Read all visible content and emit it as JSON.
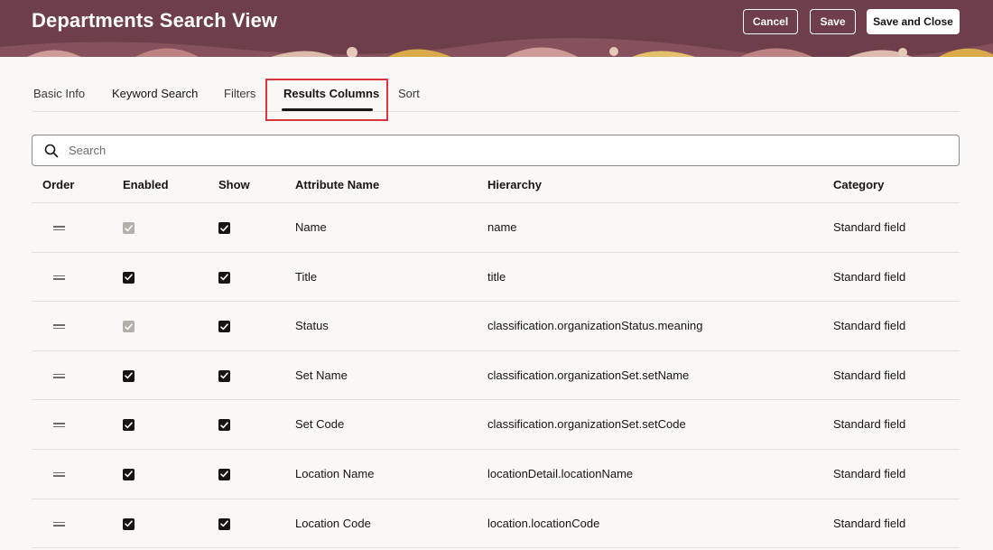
{
  "header": {
    "title": "Departments Search View",
    "cancel_label": "Cancel",
    "save_label": "Save",
    "save_close_label": "Save and Close",
    "background_color": "#6e3e4b"
  },
  "tabs": [
    {
      "label": "Basic Info",
      "selected": false
    },
    {
      "label": "Keyword Search",
      "selected": false
    },
    {
      "label": "Filters",
      "selected": false
    },
    {
      "label": "Results Columns",
      "selected": true
    },
    {
      "label": "Sort",
      "selected": false
    }
  ],
  "search": {
    "placeholder": "Search",
    "value": "",
    "icon": "search-icon"
  },
  "table": {
    "columns": [
      "Order",
      "Enabled",
      "Show",
      "Attribute Name",
      "Hierarchy",
      "Category"
    ],
    "rows": [
      {
        "enabled": "disabled-checked",
        "show": true,
        "attribute": "Name",
        "hierarchy": "name",
        "category": "Standard field"
      },
      {
        "enabled": "checked",
        "show": true,
        "attribute": "Title",
        "hierarchy": "title",
        "category": "Standard field"
      },
      {
        "enabled": "disabled-checked",
        "show": true,
        "attribute": "Status",
        "hierarchy": "classification.organizationStatus.meaning",
        "category": "Standard field"
      },
      {
        "enabled": "checked",
        "show": true,
        "attribute": "Set Name",
        "hierarchy": "classification.organizationSet.setName",
        "category": "Standard field"
      },
      {
        "enabled": "checked",
        "show": true,
        "attribute": "Set Code",
        "hierarchy": "classification.organizationSet.setCode",
        "category": "Standard field"
      },
      {
        "enabled": "checked",
        "show": true,
        "attribute": "Location Name",
        "hierarchy": "locationDetail.locationName",
        "category": "Standard field"
      },
      {
        "enabled": "checked",
        "show": true,
        "attribute": "Location Code",
        "hierarchy": "location.locationCode",
        "category": "Standard field"
      }
    ]
  },
  "colors": {
    "accent": "#161513",
    "highlight": "#e0343c",
    "disabled_check": "#b3b0ac"
  }
}
